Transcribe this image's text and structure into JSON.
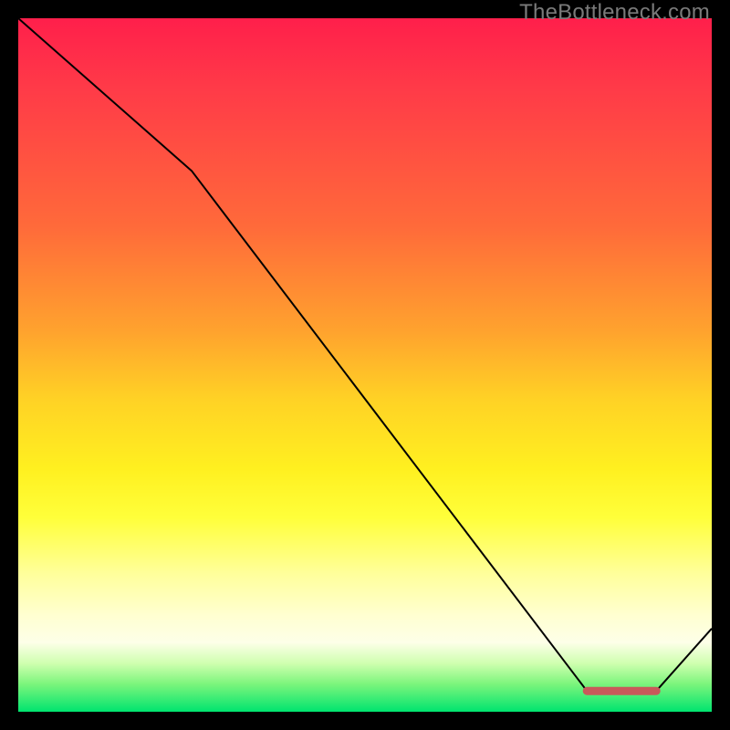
{
  "watermark": "TheBottleneck.com",
  "chart_data": {
    "type": "line",
    "title": "",
    "xlabel": "",
    "ylabel": "",
    "xlim": [
      0,
      100
    ],
    "ylim": [
      0,
      100
    ],
    "series": [
      {
        "name": "bottleneck-curve",
        "x": [
          0,
          25,
          82,
          92,
          100
        ],
        "values": [
          100,
          78,
          3,
          3,
          12
        ],
        "stroke": "#000000",
        "stroke_width": 2
      }
    ],
    "highlight_segment": {
      "name": "optimal-zone",
      "x": [
        82,
        92
      ],
      "values": [
        3,
        3
      ],
      "stroke": "#c95a5a",
      "stroke_width": 9,
      "cap": "round"
    }
  }
}
